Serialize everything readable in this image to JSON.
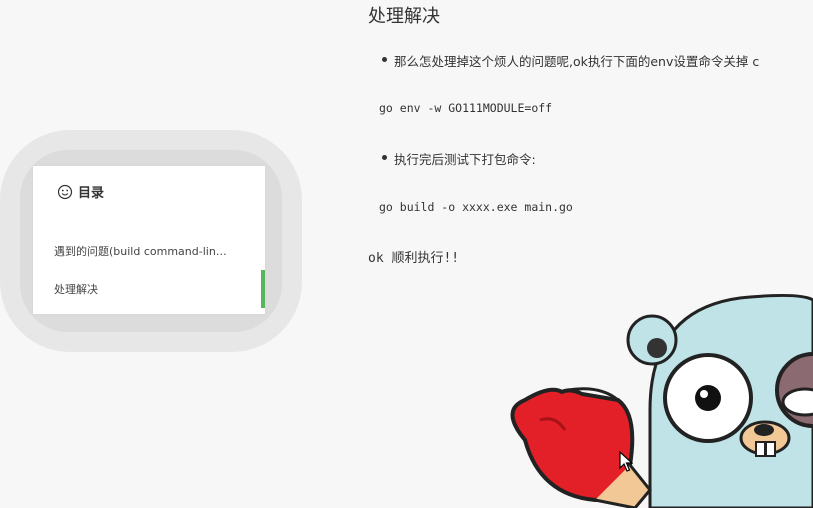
{
  "toc": {
    "title": "目录",
    "items": [
      {
        "label": "遇到的问题(build command-lin…",
        "active": false
      },
      {
        "label": "处理解决",
        "active": true
      }
    ],
    "active_color": "#58b55b"
  },
  "content": {
    "heading": "处理解决",
    "bullet1": "那么怎处理掉这个烦人的问题呢,ok执行下面的env设置命令关掉 c",
    "code1": "go env -w GO111MODULE=off",
    "bullet2": "执行完后测试下打包命令:",
    "code2": "go build -o xxxx.exe main.go",
    "para": "ok 顺利执行!!"
  },
  "decorations": {
    "mascot_icon": "gopher-boxer",
    "toc_icon": "smiley-icon"
  }
}
